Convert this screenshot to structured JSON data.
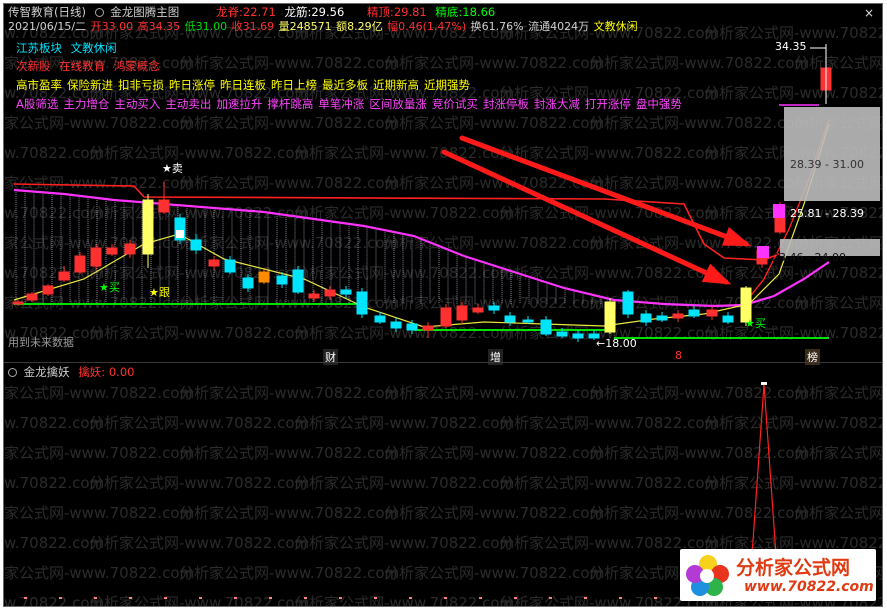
{
  "header": {
    "title": "传智教育(日线)",
    "indicator": "金龙图腾主图",
    "metrics": [
      {
        "label": "龙脊:",
        "value": "22.71",
        "color": "#ff3030"
      },
      {
        "label": "龙筋:",
        "value": "29.56",
        "color": "#ffffff"
      },
      {
        "label": "精顶:",
        "value": "29.81",
        "color": "#ff3030"
      },
      {
        "label": "精底:",
        "value": "18.66",
        "color": "#00ff00"
      }
    ]
  },
  "quote": {
    "date": "2021/06/15/二",
    "open": "开33.00",
    "high": "高34.35",
    "low": "低31.00",
    "close": "收31.69",
    "volume": "量248571",
    "amount": "额8.29亿",
    "change": "幅0.46(1.47%)",
    "turnover": "换61.76%",
    "float": "流通4024万",
    "sector": "文教休闲"
  },
  "tags": {
    "row1": [
      "江苏板块",
      "文教休闲"
    ],
    "row2": [
      "次新股",
      "在线教育",
      "鸿蒙概念"
    ],
    "row3": [
      "高市盈率",
      "保险新进",
      "扣非亏损",
      "昨日涨停",
      "昨日连板",
      "昨日上榜",
      "最近多板",
      "近期新高",
      "近期强势"
    ],
    "row4": [
      "A股筛选",
      "主力增仓",
      "主动买入",
      "主动卖出",
      "加速拉升",
      "撑杆跳高",
      "单笔冲涨",
      "区间放量涨",
      "竞价试买",
      "封涨停板",
      "封涨大减",
      "打开涨停",
      "盘中强势"
    ]
  },
  "chart_labels": {
    "sell": "★卖",
    "buy1": "★买",
    "follow": "★跟",
    "buy2": "★买",
    "future": "用到未来数据",
    "low_price": "←18.00",
    "top_price": "34.35",
    "box1": "28.39 - 31.00",
    "box2": "25.81 - 28.39",
    "box3": "23.46 - 24.00",
    "x_marks": [
      "财",
      "增",
      "8",
      "榜"
    ]
  },
  "sub_panel": {
    "name": "金龙擒妖",
    "label": "擒妖:",
    "value": "0.00"
  },
  "watermark": "分析家公式网-www.70822.com",
  "logo": {
    "name": "分析家公式网",
    "url": "www.70822.com"
  },
  "colors": {
    "up": "#ff3030",
    "down": "#00e5ff",
    "hollow_yellow": "#ffff66",
    "magenta": "#ff33ff",
    "green": "#00ff00",
    "sell_star": "#ffffff",
    "buy_star": "#00ff00",
    "follow_star": "#ffff00"
  }
}
